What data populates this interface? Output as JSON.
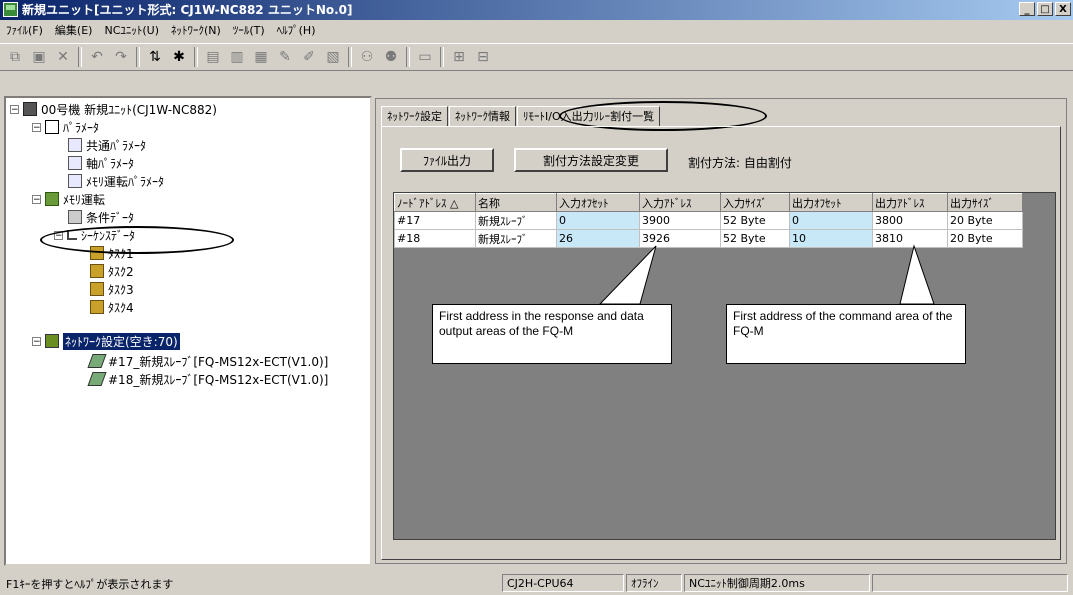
{
  "window": {
    "title": "新規ユニット[ユニット形式: CJ1W-NC882 ユニットNo.0]",
    "buttons": [
      "_",
      "□",
      "X"
    ]
  },
  "menu": [
    "ﾌｧｲﾙ(F)",
    "編集(E)",
    "NCﾕﾆｯﾄ(U)",
    "ﾈｯﾄﾜｰｸ(N)",
    "ﾂｰﾙ(T)",
    "ﾍﾙﾌﾟ(H)"
  ],
  "tree": {
    "root": "00号機 新規ﾕﾆｯﾄ(CJ1W-NC882)",
    "param": "ﾊﾟﾗﾒｰﾀ",
    "common_param": "共通ﾊﾟﾗﾒｰﾀ",
    "axis_param": "軸ﾊﾟﾗﾒｰﾀ",
    "memory_param": "ﾒﾓﾘ運転ﾊﾟﾗﾒｰﾀ",
    "memory_op": "ﾒﾓﾘ運転",
    "cond_data": "条件ﾃﾞｰﾀ",
    "seq_data": "ｼｰｹﾝｽﾃﾞｰﾀ",
    "tasks": [
      "ﾀｽｸ1",
      "ﾀｽｸ2",
      "ﾀｽｸ3",
      "ﾀｽｸ4"
    ],
    "network": "ﾈｯﾄﾜｰｸ設定(空き:70)",
    "slave17": "#17_新規ｽﾚｰﾌﾞ[FQ-MS12x-ECT(V1.0)]",
    "slave18": "#18_新規ｽﾚｰﾌﾞ[FQ-MS12x-ECT(V1.0)]"
  },
  "tabs": [
    "ﾈｯﾄﾜｰｸ設定",
    "ﾈｯﾄﾜｰｸ情報",
    "ﾘﾓｰﾄI/O入出力ﾘﾚｰ割付一覧"
  ],
  "buttons": {
    "file_output": "ﾌｧｲﾙ出力",
    "change_method": "割付方法設定変更"
  },
  "assign_method": "割付方法: 自由割付",
  "table": {
    "headers": [
      "ﾉｰﾄﾞｱﾄﾞﾚｽ △",
      "名称",
      "入力ｵﾌｾｯﾄ",
      "入力ｱﾄﾞﾚｽ",
      "入力ｻｲｽﾞ",
      "出力ｵﾌｾｯﾄ",
      "出力ｱﾄﾞﾚｽ",
      "出力ｻｲｽﾞ"
    ],
    "rows": [
      [
        "#17",
        "新規ｽﾚｰﾌﾞ",
        "0",
        "3900",
        "52 Byte",
        "0",
        "3800",
        "20 Byte"
      ],
      [
        "#18",
        "新規ｽﾚｰﾌﾞ",
        "26",
        "3926",
        "52 Byte",
        "10",
        "3810",
        "20 Byte"
      ]
    ]
  },
  "callouts": {
    "response": "First address in the response and data output areas of the FQ-M",
    "command": "First address of the command area of the FQ-M"
  },
  "status": {
    "help": "F1ｷｰを押すとﾍﾙﾌﾟが表示されます",
    "cpu": "CJ2H-CPU64",
    "mode": "ｵﾌﾗｲﾝ",
    "cycle": "NCﾕﾆｯﾄ制御周期2.0ms"
  }
}
